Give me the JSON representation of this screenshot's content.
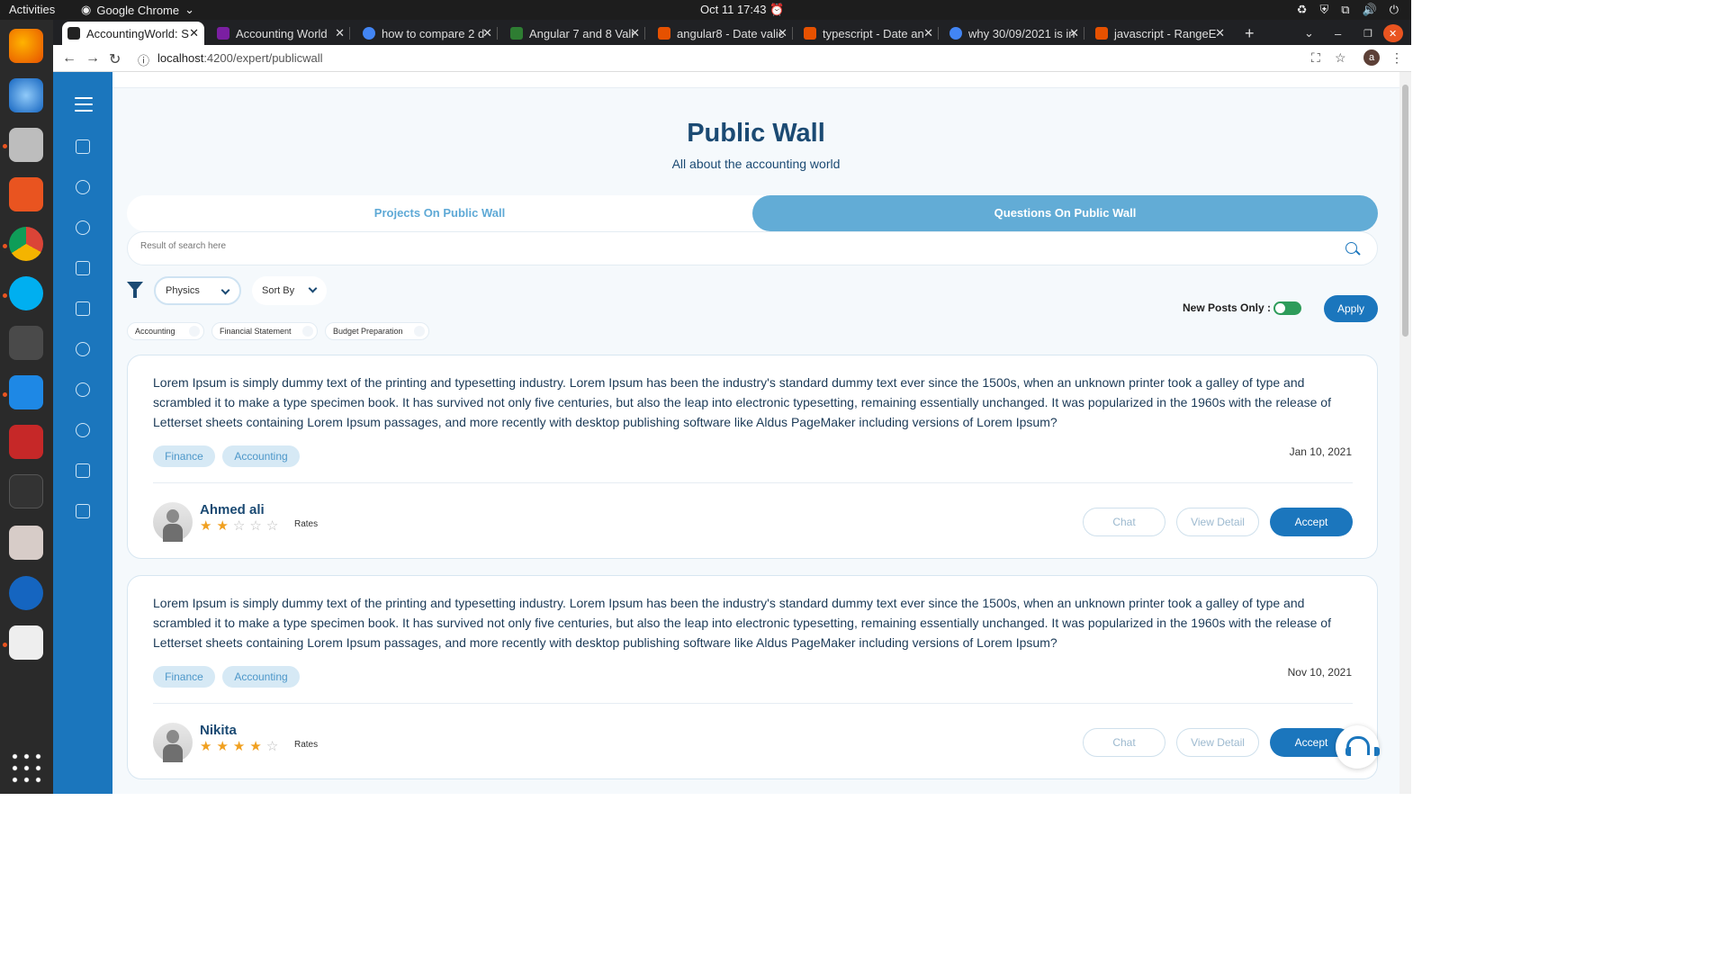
{
  "os": {
    "activities": "Activities",
    "app": "Google Chrome",
    "clock": "Oct 11  17:43"
  },
  "tabs": [
    {
      "title": "AccountingWorld: S",
      "color": "#222222"
    },
    {
      "title": "Accounting World",
      "color": "#7b1fa2"
    },
    {
      "title": "how to compare 2 d",
      "color": "#4285f4"
    },
    {
      "title": "Angular 7 and 8 Vali",
      "color": "#2e7d32"
    },
    {
      "title": "angular8 - Date valic",
      "color": "#e65100"
    },
    {
      "title": "typescript - Date an",
      "color": "#e65100"
    },
    {
      "title": "why 30/09/2021 is in",
      "color": "#4285f4"
    },
    {
      "title": "javascript - RangeE",
      "color": "#e65100"
    }
  ],
  "omnibox": {
    "host": "localhost",
    "path": ":4200/expert/publicwall",
    "profile": "a"
  },
  "header": {
    "title": "Public Wall",
    "subtitle": "All about the accounting world"
  },
  "tabs_main": {
    "projects": "Projects On Public Wall",
    "questions": "Questions On Public Wall"
  },
  "search": {
    "placeholder": "Result of search here"
  },
  "filters": {
    "category": "Physics",
    "sort": "Sort By",
    "new_posts_label": "New Posts Only :",
    "new_posts_on": true,
    "apply": "Apply"
  },
  "chips": [
    "Accounting",
    "Financial Statement",
    "Budget Preparation"
  ],
  "posts": [
    {
      "text": "Lorem Ipsum is simply dummy text of the printing and typesetting industry. Lorem Ipsum has been the industry's standard dummy text ever since the 1500s, when an unknown printer took a galley of type and scrambled it to make a type specimen book. It has survived not only five centuries, but also the leap into electronic typesetting, remaining essentially unchanged. It was popularized in the 1960s with the release of Letterset sheets containing Lorem Ipsum passages, and more recently with desktop publishing software like Aldus PageMaker including versions of Lorem Ipsum?",
      "tags": [
        "Finance",
        "Accounting"
      ],
      "date": "Jan 10, 2021",
      "author": "Ahmed ali",
      "rating": 2,
      "rates_label": "Rates",
      "chat": "Chat",
      "view": "View Detail",
      "accept": "Accept"
    },
    {
      "text": "Lorem Ipsum is simply dummy text of the printing and typesetting industry. Lorem Ipsum has been the industry's standard dummy text ever since the 1500s, when an unknown printer took a galley of type and scrambled it to make a type specimen book. It has survived not only five centuries, but also the leap into electronic typesetting, remaining essentially unchanged. It was popularized in the 1960s with the release of Letterset sheets containing Lorem Ipsum passages, and more recently with desktop publishing software like Aldus PageMaker including versions of Lorem Ipsum?",
      "tags": [
        "Finance",
        "Accounting"
      ],
      "date": "Nov 10, 2021",
      "author": "Nikita",
      "rating": 4,
      "rates_label": "Rates",
      "chat": "Chat",
      "view": "View Detail",
      "accept": "Accept"
    }
  ],
  "colors": {
    "primary": "#1b76bd",
    "heading": "#1b4a73",
    "tab_active": "#62acd6",
    "toggle_on": "#2e9c5a",
    "star": "#f0a020"
  }
}
